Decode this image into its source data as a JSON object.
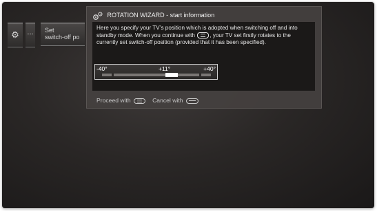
{
  "settings_strip": {
    "gear_icon": "gear-icon",
    "dots": "...",
    "setting_line1": "Set",
    "setting_line2": "switch-off po"
  },
  "wizard": {
    "title": "ROTATION WIZARD - start information",
    "title_icon": "gears-icon",
    "info_part1": "Here you specify your TV’s position which is adopted when switching off and into standby mode.  When you continue with",
    "info_key_icon": "forward-key-icon",
    "info_part2": ", your TV set firstly rotates to the currently set switch-off position (provided that it has been specified).",
    "slider": {
      "min_label": "-40°",
      "current_label": "+11°",
      "max_label": "+40°",
      "min": -40,
      "max": 40,
      "value": 11
    },
    "footer": {
      "proceed_label": "Proceed with",
      "proceed_key_icon": "forward-key-icon",
      "cancel_label": "Cancel with",
      "cancel_key_icon": "back-key-icon"
    }
  }
}
